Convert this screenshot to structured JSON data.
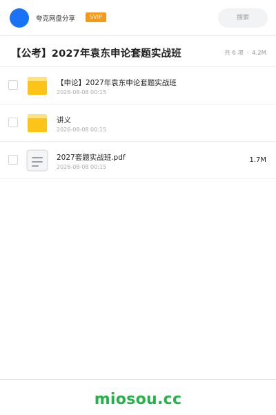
{
  "header": {
    "brand": "夸克网盘分享",
    "badge": "SVIP",
    "search_label": "搜索"
  },
  "share": {
    "title": "【公考】2027年袁东申论套题实战班",
    "count": "共 6 项",
    "separator": "·",
    "size": "4.2M"
  },
  "files": [
    {
      "type": "folder",
      "icon": "folder-icon",
      "name": "【申论】2027年袁东申论套题实战班",
      "date": "2026-08-08 00:15",
      "size": ""
    },
    {
      "type": "folder",
      "icon": "folder-icon",
      "name": "讲义",
      "date": "2026-08-08 00:15",
      "size": ""
    },
    {
      "type": "file",
      "icon": "document-icon",
      "name": "2027套题实战班.pdf",
      "date": "2026-08-08 00:15",
      "size": "1.7M"
    }
  ],
  "footer": {
    "site": "miosou.cc"
  },
  "colors": {
    "avatar": "#1a73f5",
    "badge": "#f39a1b",
    "folder": "#fcc419",
    "site": "#27b14a"
  }
}
